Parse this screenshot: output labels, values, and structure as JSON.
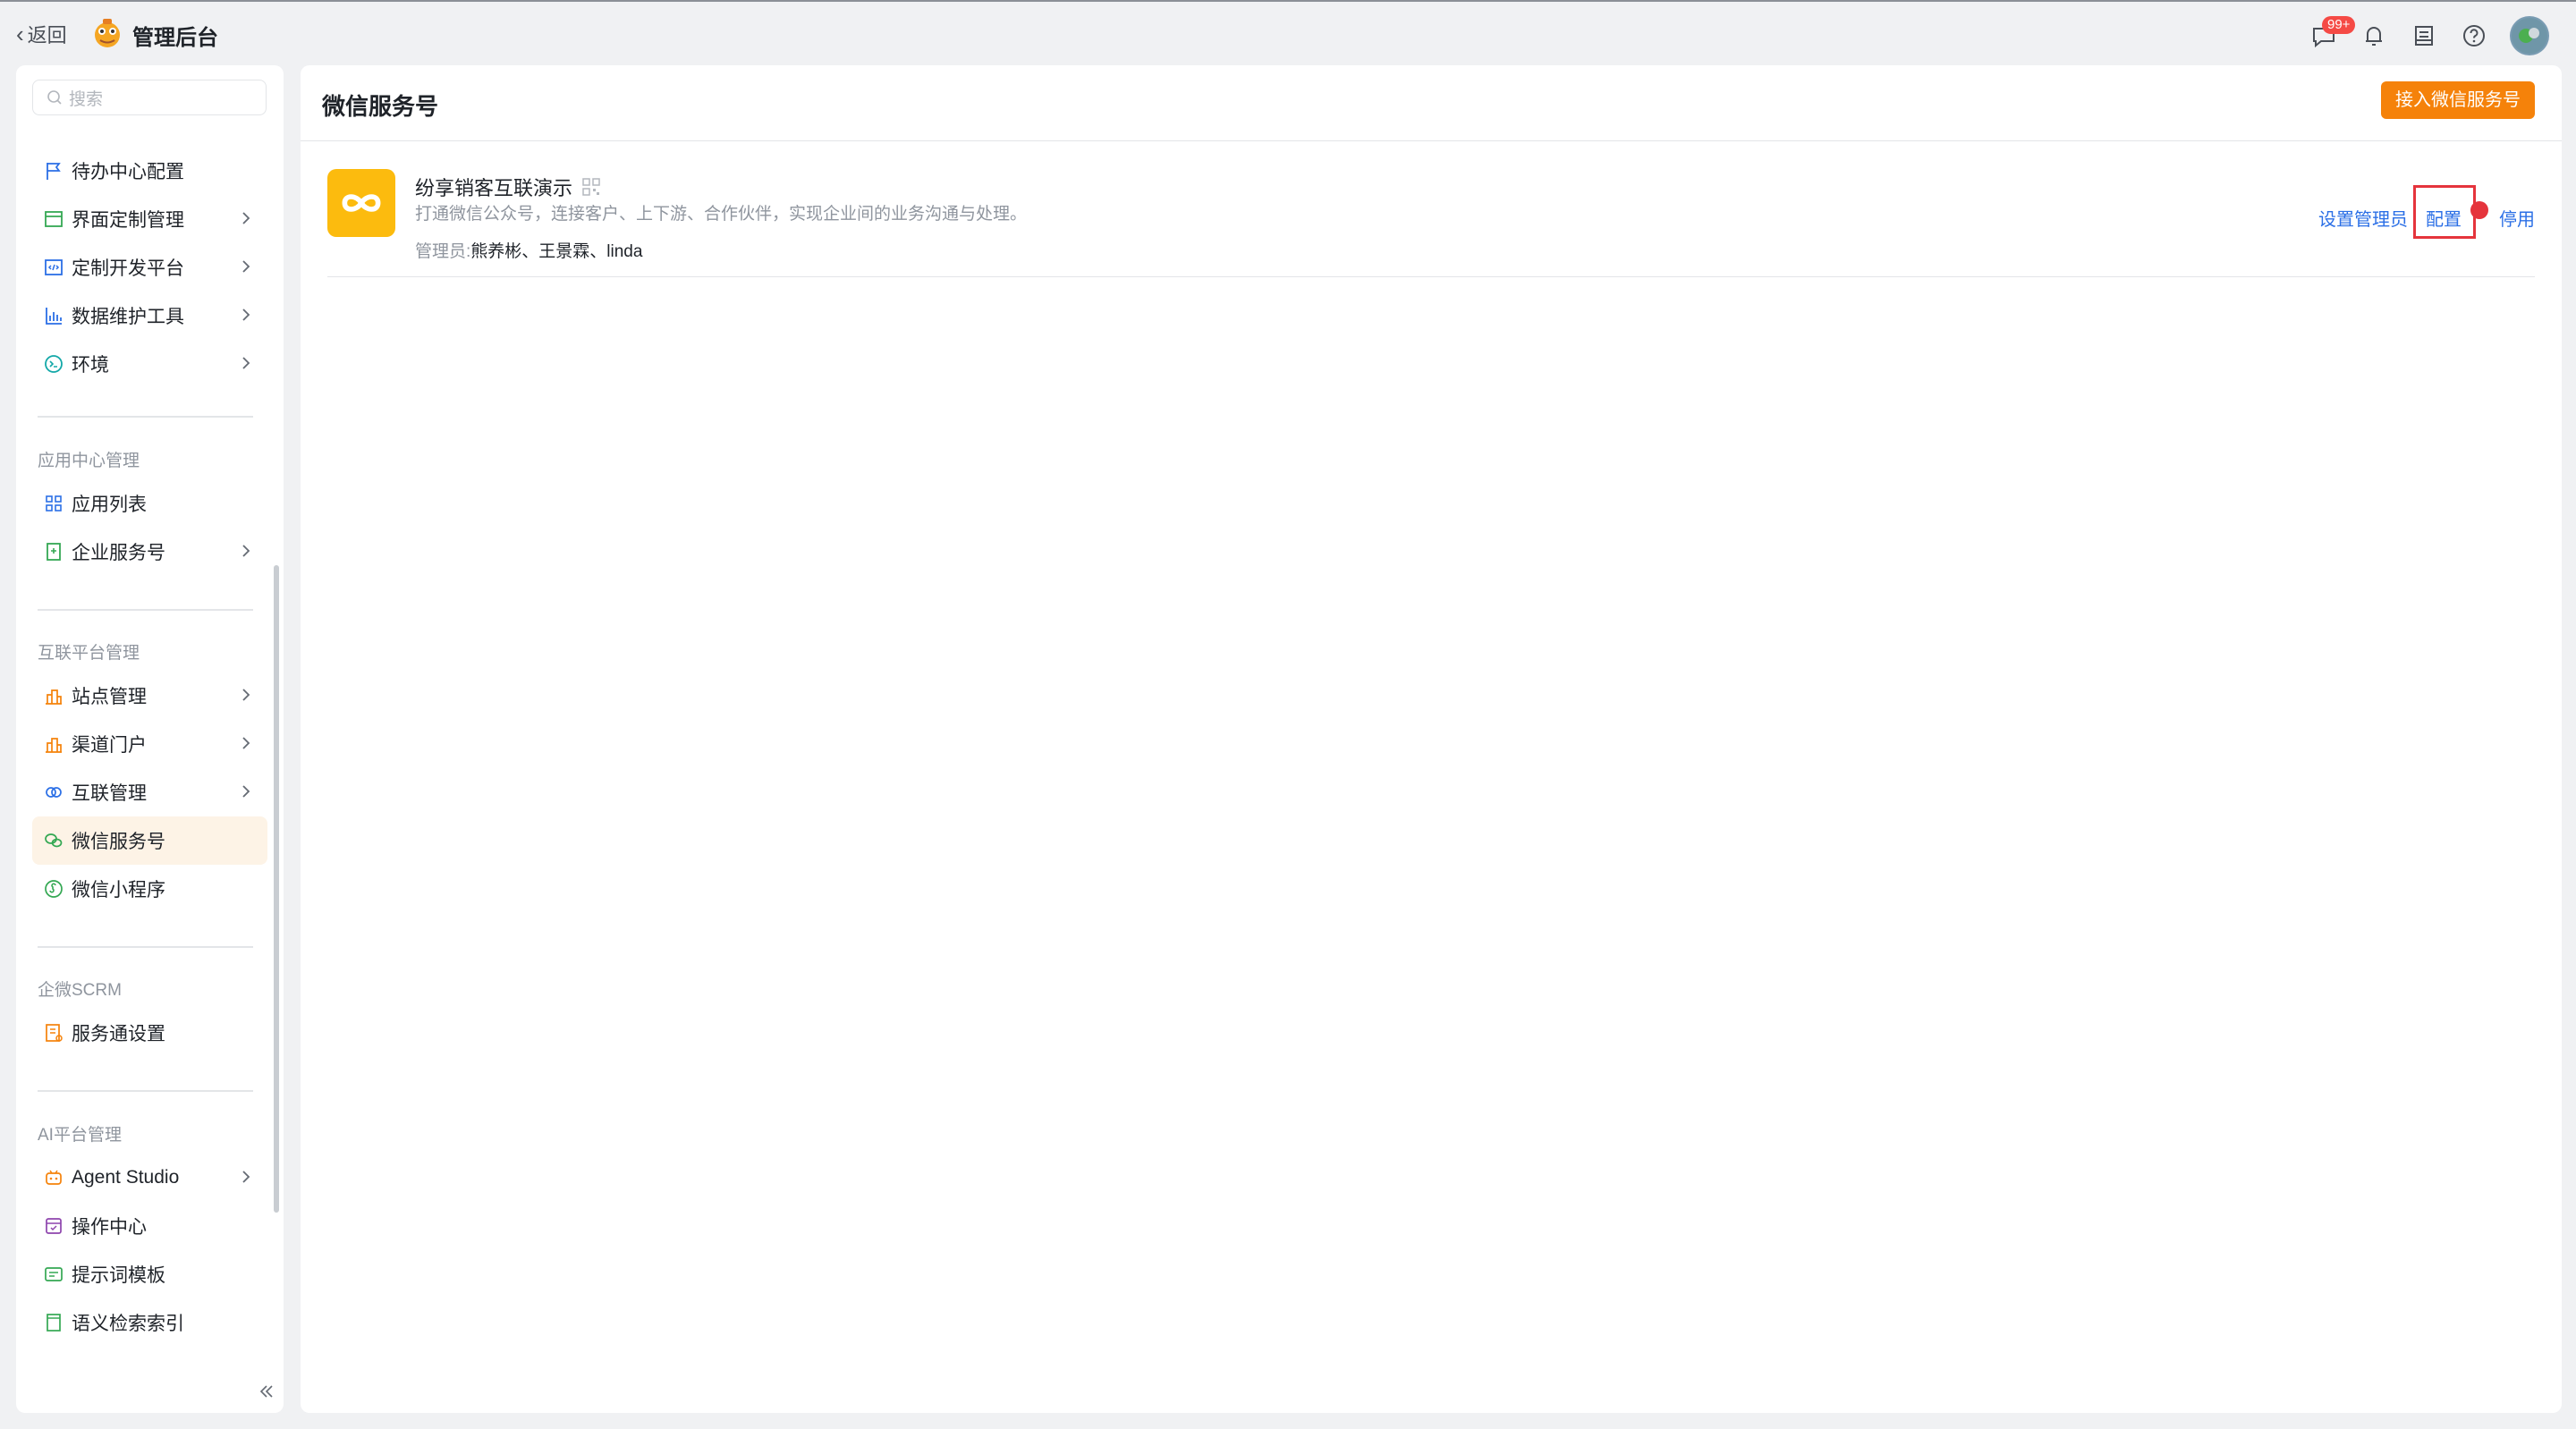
{
  "topbar": {
    "back_label": "返回",
    "app_title": "管理后台",
    "message_badge": "99+",
    "icons": [
      "message-icon",
      "bell-icon",
      "inbox-icon",
      "help-icon",
      "avatar"
    ]
  },
  "sidebar": {
    "search_placeholder": "搜索",
    "items_top": [
      {
        "label": "待办中心配置",
        "icon": "flag-icon",
        "has_arrow": false
      },
      {
        "label": "界面定制管理",
        "icon": "layout-icon",
        "has_arrow": true
      },
      {
        "label": "定制开发平台",
        "icon": "code-icon",
        "has_arrow": true
      },
      {
        "label": "数据维护工具",
        "icon": "bar-chart-icon",
        "has_arrow": true
      },
      {
        "label": "环境",
        "icon": "environment-icon",
        "has_arrow": true
      }
    ],
    "group_app": {
      "title": "应用中心管理",
      "items": [
        {
          "label": "应用列表",
          "icon": "grid-icon",
          "has_arrow": false
        },
        {
          "label": "企业服务号",
          "icon": "enterprise-icon",
          "has_arrow": true
        }
      ]
    },
    "group_interconnect": {
      "title": "互联平台管理",
      "items": [
        {
          "label": "站点管理",
          "icon": "site-icon",
          "has_arrow": true
        },
        {
          "label": "渠道门户",
          "icon": "portal-icon",
          "has_arrow": true
        },
        {
          "label": "互联管理",
          "icon": "link-rings-icon",
          "has_arrow": true
        },
        {
          "label": "微信服务号",
          "icon": "wechat-icon",
          "has_arrow": false,
          "active": true
        },
        {
          "label": "微信小程序",
          "icon": "miniprogram-icon",
          "has_arrow": false
        }
      ]
    },
    "group_scrm": {
      "title": "企微SCRM",
      "items": [
        {
          "label": "服务通设置",
          "icon": "service-settings-icon",
          "has_arrow": false
        }
      ]
    },
    "group_ai": {
      "title": "AI平台管理",
      "items": [
        {
          "label": "Agent Studio",
          "icon": "robot-icon",
          "has_arrow": true
        },
        {
          "label": "操作中心",
          "icon": "operation-icon",
          "has_arrow": false
        },
        {
          "label": "提示词模板",
          "icon": "template-icon",
          "has_arrow": false
        },
        {
          "label": "语义检索索引",
          "icon": "index-icon",
          "has_arrow": false
        }
      ]
    }
  },
  "main": {
    "title": "微信服务号",
    "add_button": "接入微信服务号",
    "account": {
      "name": "纷享销客互联演示",
      "description": "打通微信公众号，连接客户、上下游、合作伙伴，实现企业间的业务沟通与处理。",
      "admins_label": "管理员:",
      "admins": "熊养彬、王景霖、linda",
      "actions": {
        "set_admin": "设置管理员",
        "configure": "配置",
        "disable": "停用"
      }
    }
  },
  "colors": {
    "accent": "#f5820a",
    "link": "#2b6fe6",
    "active_bg": "#fdf3e6",
    "highlight_red": "#e5343c",
    "app_logo_bg": "#fcbb0e"
  }
}
